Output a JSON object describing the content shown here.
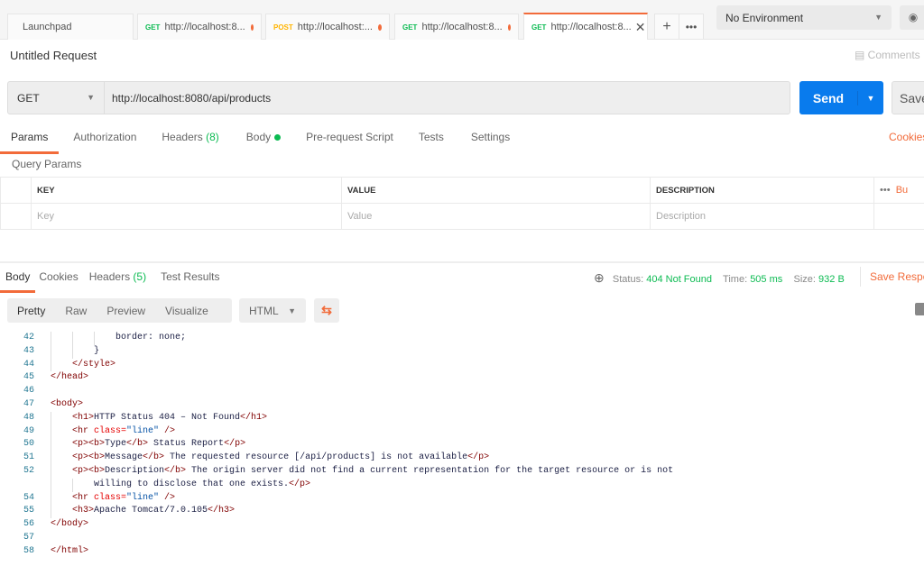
{
  "tabs": [
    {
      "label": "Launchpad"
    },
    {
      "method": "GET",
      "label": "http://localhost:8...",
      "unsaved": true
    },
    {
      "method": "POST",
      "label": "http://localhost:...",
      "unsaved": true
    },
    {
      "method": "GET",
      "label": "http://localhost:8...",
      "unsaved": true
    },
    {
      "method": "GET",
      "label": "http://localhost:8...",
      "active": true
    }
  ],
  "environment": "No Environment",
  "request": {
    "title": "Untitled Request",
    "comments": "Comments",
    "method": "GET",
    "url": "http://localhost:8080/api/products",
    "send": "Send",
    "save": "Save"
  },
  "request_tabs": {
    "params": "Params",
    "authorization": "Authorization",
    "headers": "Headers",
    "headers_count": "(8)",
    "body": "Body",
    "prerequest": "Pre-request Script",
    "tests": "Tests",
    "settings": "Settings",
    "cookies": "Cookies"
  },
  "query_params": {
    "title": "Query Params",
    "columns": [
      "KEY",
      "VALUE",
      "DESCRIPTION"
    ],
    "placeholders": [
      "Key",
      "Value",
      "Description"
    ],
    "bulk": "Bu"
  },
  "response": {
    "tabs": {
      "body": "Body",
      "cookies": "Cookies",
      "headers": "Headers",
      "headers_count": "(5)",
      "tests": "Test Results"
    },
    "status_label": "Status:",
    "status": "404 Not Found",
    "time_label": "Time:",
    "time": "505 ms",
    "size_label": "Size:",
    "size": "932 B",
    "save": "Save Respo",
    "views": [
      "Pretty",
      "Raw",
      "Preview",
      "Visualize"
    ],
    "format": "HTML"
  },
  "colors": {
    "accent": "#f26b3a",
    "send": "#097bed",
    "success": "#0cbb52"
  },
  "code": [
    {
      "n": "42",
      "i": 3,
      "s": [
        [
          "txt",
          "border: none;"
        ]
      ]
    },
    {
      "n": "43",
      "i": 2,
      "s": [
        [
          "txt",
          "}"
        ]
      ]
    },
    {
      "n": "44",
      "i": 1,
      "s": [
        [
          "tag",
          "</style>"
        ]
      ]
    },
    {
      "n": "45",
      "i": 0,
      "s": [
        [
          "tag",
          "</head>"
        ]
      ]
    },
    {
      "n": "46",
      "i": 0,
      "s": []
    },
    {
      "n": "47",
      "i": 0,
      "s": [
        [
          "tag",
          "<body>"
        ]
      ]
    },
    {
      "n": "48",
      "i": 1,
      "s": [
        [
          "tag",
          "<h1>"
        ],
        [
          "txt",
          "HTTP Status 404 – Not Found"
        ],
        [
          "tag",
          "</h1>"
        ]
      ]
    },
    {
      "n": "49",
      "i": 1,
      "s": [
        [
          "tag",
          "<hr "
        ],
        [
          "attr",
          "class="
        ],
        [
          "val",
          "\"line\""
        ],
        [
          "tag",
          " />"
        ]
      ]
    },
    {
      "n": "50",
      "i": 1,
      "s": [
        [
          "tag",
          "<p><b>"
        ],
        [
          "txt",
          "Type"
        ],
        [
          "tag",
          "</b>"
        ],
        [
          "txt",
          " Status Report"
        ],
        [
          "tag",
          "</p>"
        ]
      ]
    },
    {
      "n": "51",
      "i": 1,
      "s": [
        [
          "tag",
          "<p><b>"
        ],
        [
          "txt",
          "Message"
        ],
        [
          "tag",
          "</b>"
        ],
        [
          "txt",
          " The requested resource [/api/products] is not available"
        ],
        [
          "tag",
          "</p>"
        ]
      ]
    },
    {
      "n": "52",
      "i": 1,
      "s": [
        [
          "tag",
          "<p><b>"
        ],
        [
          "txt",
          "Description"
        ],
        [
          "tag",
          "</b>"
        ],
        [
          "txt",
          " The origin server did not find a current representation for the target resource or is not"
        ]
      ]
    },
    {
      "n": "",
      "i": 2,
      "s": [
        [
          "txt",
          "willing to disclose that one exists."
        ],
        [
          "tag",
          "</p>"
        ]
      ]
    },
    {
      "n": "54",
      "i": 1,
      "s": [
        [
          "tag",
          "<hr "
        ],
        [
          "attr",
          "class="
        ],
        [
          "val",
          "\"line\""
        ],
        [
          "tag",
          " />"
        ]
      ]
    },
    {
      "n": "55",
      "i": 1,
      "s": [
        [
          "tag",
          "<h3>"
        ],
        [
          "txt",
          "Apache Tomcat/7.0.105"
        ],
        [
          "tag",
          "</h3>"
        ]
      ]
    },
    {
      "n": "56",
      "i": 0,
      "s": [
        [
          "tag",
          "</body>"
        ]
      ]
    },
    {
      "n": "57",
      "i": 0,
      "s": []
    },
    {
      "n": "58",
      "i": 0,
      "s": [
        [
          "tag",
          "</html>"
        ]
      ]
    }
  ]
}
